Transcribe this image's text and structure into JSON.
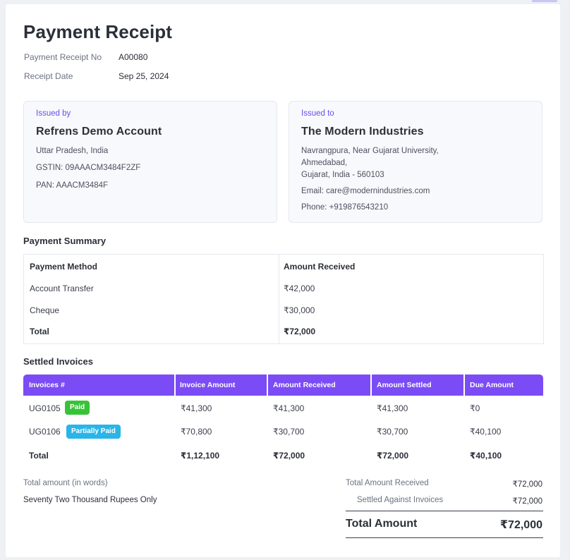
{
  "receipt": {
    "title": "Payment Receipt",
    "no_label": "Payment Receipt No",
    "no_value": "A00080",
    "date_label": "Receipt Date",
    "date_value": "Sep 25, 2024"
  },
  "issued_by": {
    "tag": "Issued by",
    "name": "Refrens Demo Account",
    "lines": [
      "Uttar Pradesh, India",
      "GSTIN: 09AAACM3484F2ZF",
      "PAN: AAACM3484F"
    ]
  },
  "issued_to": {
    "tag": "Issued to",
    "name": "The Modern Industries",
    "address": [
      "Navrangpura, Near Gujarat University,",
      "Ahmedabad,",
      "Gujarat, India - 560103"
    ],
    "email": "Email: care@modernindustries.com",
    "phone": "Phone: +919876543210"
  },
  "payment_summary": {
    "title": "Payment Summary",
    "headers": [
      "Payment Method",
      "Amount Received"
    ],
    "rows": [
      [
        "Account Transfer",
        "₹42,000"
      ],
      [
        "Cheque",
        "₹30,000"
      ]
    ],
    "total": [
      "Total",
      "₹72,000"
    ]
  },
  "settled_invoices": {
    "title": "Settled Invoices",
    "headers": [
      "Invoices #",
      "Invoice Amount",
      "Amount Received",
      "Amount Settled",
      "Due Amount"
    ],
    "rows": [
      {
        "id": "UG0105",
        "status": "Paid",
        "invoice_amount": "₹41,300",
        "amount_received": "₹41,300",
        "amount_settled": "₹41,300",
        "due_amount": "₹0"
      },
      {
        "id": "UG0106",
        "status": "Partially Paid",
        "invoice_amount": "₹70,800",
        "amount_received": "₹30,700",
        "amount_settled": "₹30,700",
        "due_amount": "₹40,100"
      }
    ],
    "total": {
      "label": "Total",
      "invoice_amount": "₹1,12,100",
      "amount_received": "₹72,000",
      "amount_settled": "₹72,000",
      "due_amount": "₹40,100"
    }
  },
  "totals": {
    "words_label": "Total amount (in words)",
    "words_value": "Seventy Two Thousand Rupees Only",
    "received_label": "Total Amount Received",
    "received_value": "₹72,000",
    "settled_label": "Settled Against Invoices",
    "settled_value": "₹72,000",
    "grand_label": "Total Amount",
    "grand_value": "₹72,000"
  },
  "colors": {
    "accent": "#7b4cf5",
    "tag": "#6a4cf0",
    "paid_badge": "#38c238",
    "partial_badge": "#29b5e8"
  }
}
